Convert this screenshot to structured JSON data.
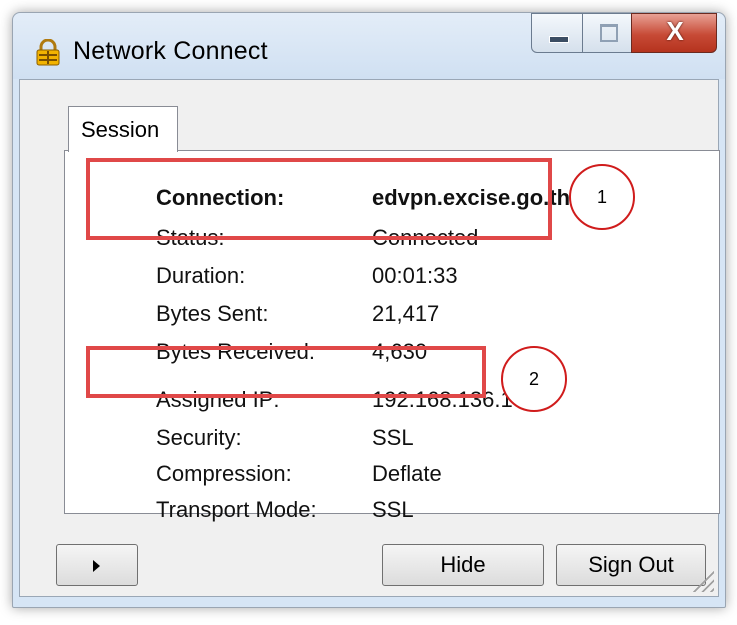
{
  "window": {
    "title": "Network Connect",
    "controls": {
      "minimize": "minimize",
      "maximize": "maximize",
      "close": "X"
    }
  },
  "tabs": [
    {
      "label": "Session",
      "active": true
    }
  ],
  "session": {
    "rows": [
      {
        "label": "Connection:",
        "value": "edvpn.excise.go.th"
      },
      {
        "label": "Status:",
        "value": "Connected"
      },
      {
        "label": "Duration:",
        "value": "00:01:33"
      },
      {
        "label": "Bytes Sent:",
        "value": "21,417"
      },
      {
        "label": "Bytes Received:",
        "value": "4,630"
      },
      {
        "label": "Assigned IP:",
        "value": "192.168.136.101"
      },
      {
        "label": "Security:",
        "value": "SSL"
      },
      {
        "label": "Compression:",
        "value": "Deflate"
      },
      {
        "label": "Transport Mode:",
        "value": "SSL"
      }
    ]
  },
  "annotations": {
    "callout_1": "1",
    "callout_2": "2",
    "highlight_color": "#e04848",
    "circle_color": "#d01c1c"
  },
  "buttons": {
    "expand": "expand-arrow",
    "hide": "Hide",
    "sign_out": "Sign Out"
  },
  "icons": {
    "app": "padlock-network-icon",
    "expand": "triangle-right-icon",
    "resize": "resize-grip-icon"
  }
}
